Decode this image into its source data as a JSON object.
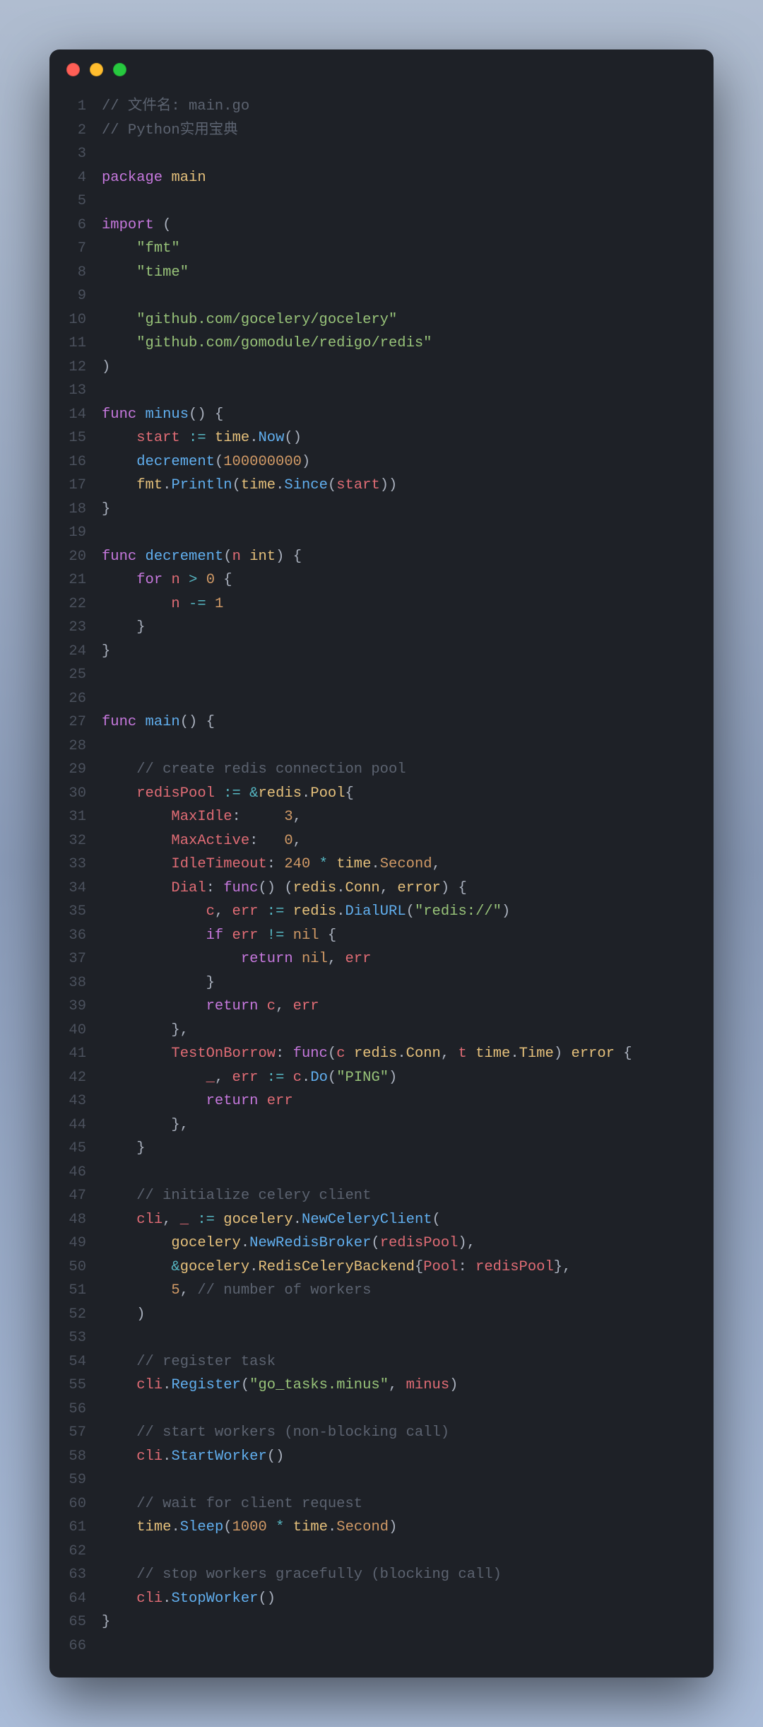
{
  "window": {
    "buttons": [
      "close",
      "minimize",
      "maximize"
    ]
  },
  "editor": {
    "language": "go",
    "line_count": 66,
    "lines": [
      [
        {
          "t": "// 文件名: main.go",
          "c": "comment"
        }
      ],
      [
        {
          "t": "// Python实用宝典",
          "c": "comment"
        }
      ],
      [],
      [
        {
          "t": "package",
          "c": "keyword"
        },
        {
          "t": " "
        },
        {
          "t": "main",
          "c": "pkg"
        }
      ],
      [],
      [
        {
          "t": "import",
          "c": "keyword"
        },
        {
          "t": " ("
        }
      ],
      [
        {
          "t": "    "
        },
        {
          "t": "\"fmt\"",
          "c": "string"
        }
      ],
      [
        {
          "t": "    "
        },
        {
          "t": "\"time\"",
          "c": "string"
        }
      ],
      [],
      [
        {
          "t": "    "
        },
        {
          "t": "\"github.com/gocelery/gocelery\"",
          "c": "string"
        }
      ],
      [
        {
          "t": "    "
        },
        {
          "t": "\"github.com/gomodule/redigo/redis\"",
          "c": "string"
        }
      ],
      [
        {
          "t": ")"
        }
      ],
      [],
      [
        {
          "t": "func",
          "c": "keyword"
        },
        {
          "t": " "
        },
        {
          "t": "minus",
          "c": "func"
        },
        {
          "t": "() {"
        }
      ],
      [
        {
          "t": "    "
        },
        {
          "t": "start",
          "c": "var"
        },
        {
          "t": " "
        },
        {
          "t": ":=",
          "c": "op"
        },
        {
          "t": " "
        },
        {
          "t": "time",
          "c": "pkg"
        },
        {
          "t": "."
        },
        {
          "t": "Now",
          "c": "func"
        },
        {
          "t": "()"
        }
      ],
      [
        {
          "t": "    "
        },
        {
          "t": "decrement",
          "c": "func"
        },
        {
          "t": "("
        },
        {
          "t": "100000000",
          "c": "num"
        },
        {
          "t": ")"
        }
      ],
      [
        {
          "t": "    "
        },
        {
          "t": "fmt",
          "c": "pkg"
        },
        {
          "t": "."
        },
        {
          "t": "Println",
          "c": "func"
        },
        {
          "t": "("
        },
        {
          "t": "time",
          "c": "pkg"
        },
        {
          "t": "."
        },
        {
          "t": "Since",
          "c": "func"
        },
        {
          "t": "("
        },
        {
          "t": "start",
          "c": "var"
        },
        {
          "t": "))"
        }
      ],
      [
        {
          "t": "}"
        }
      ],
      [],
      [
        {
          "t": "func",
          "c": "keyword"
        },
        {
          "t": " "
        },
        {
          "t": "decrement",
          "c": "func"
        },
        {
          "t": "("
        },
        {
          "t": "n",
          "c": "var"
        },
        {
          "t": " "
        },
        {
          "t": "int",
          "c": "type"
        },
        {
          "t": ") {"
        }
      ],
      [
        {
          "t": "    "
        },
        {
          "t": "for",
          "c": "keyword"
        },
        {
          "t": " "
        },
        {
          "t": "n",
          "c": "var"
        },
        {
          "t": " "
        },
        {
          "t": ">",
          "c": "op"
        },
        {
          "t": " "
        },
        {
          "t": "0",
          "c": "num"
        },
        {
          "t": " {"
        }
      ],
      [
        {
          "t": "        "
        },
        {
          "t": "n",
          "c": "var"
        },
        {
          "t": " "
        },
        {
          "t": "-=",
          "c": "op"
        },
        {
          "t": " "
        },
        {
          "t": "1",
          "c": "num"
        }
      ],
      [
        {
          "t": "    }"
        }
      ],
      [
        {
          "t": "}"
        }
      ],
      [],
      [],
      [
        {
          "t": "func",
          "c": "keyword"
        },
        {
          "t": " "
        },
        {
          "t": "main",
          "c": "func"
        },
        {
          "t": "() {"
        }
      ],
      [],
      [
        {
          "t": "    "
        },
        {
          "t": "// create redis connection pool",
          "c": "comment"
        }
      ],
      [
        {
          "t": "    "
        },
        {
          "t": "redisPool",
          "c": "var"
        },
        {
          "t": " "
        },
        {
          "t": ":=",
          "c": "op"
        },
        {
          "t": " "
        },
        {
          "t": "&",
          "c": "op"
        },
        {
          "t": "redis",
          "c": "pkg"
        },
        {
          "t": "."
        },
        {
          "t": "Pool",
          "c": "type"
        },
        {
          "t": "{"
        }
      ],
      [
        {
          "t": "        "
        },
        {
          "t": "MaxIdle",
          "c": "field"
        },
        {
          "t": ":     "
        },
        {
          "t": "3",
          "c": "num"
        },
        {
          "t": ","
        }
      ],
      [
        {
          "t": "        "
        },
        {
          "t": "MaxActive",
          "c": "field"
        },
        {
          "t": ":   "
        },
        {
          "t": "0",
          "c": "num"
        },
        {
          "t": ","
        }
      ],
      [
        {
          "t": "        "
        },
        {
          "t": "IdleTimeout",
          "c": "field"
        },
        {
          "t": ": "
        },
        {
          "t": "240",
          "c": "num"
        },
        {
          "t": " "
        },
        {
          "t": "*",
          "c": "op"
        },
        {
          "t": " "
        },
        {
          "t": "time",
          "c": "pkg"
        },
        {
          "t": "."
        },
        {
          "t": "Second",
          "c": "const"
        },
        {
          "t": ","
        }
      ],
      [
        {
          "t": "        "
        },
        {
          "t": "Dial",
          "c": "field"
        },
        {
          "t": ": "
        },
        {
          "t": "func",
          "c": "keyword"
        },
        {
          "t": "() ("
        },
        {
          "t": "redis",
          "c": "pkg"
        },
        {
          "t": "."
        },
        {
          "t": "Conn",
          "c": "type"
        },
        {
          "t": ", "
        },
        {
          "t": "error",
          "c": "type"
        },
        {
          "t": ") {"
        }
      ],
      [
        {
          "t": "            "
        },
        {
          "t": "c",
          "c": "var"
        },
        {
          "t": ", "
        },
        {
          "t": "err",
          "c": "var"
        },
        {
          "t": " "
        },
        {
          "t": ":=",
          "c": "op"
        },
        {
          "t": " "
        },
        {
          "t": "redis",
          "c": "pkg"
        },
        {
          "t": "."
        },
        {
          "t": "DialURL",
          "c": "func"
        },
        {
          "t": "("
        },
        {
          "t": "\"redis://\"",
          "c": "string"
        },
        {
          "t": ")"
        }
      ],
      [
        {
          "t": "            "
        },
        {
          "t": "if",
          "c": "keyword"
        },
        {
          "t": " "
        },
        {
          "t": "err",
          "c": "var"
        },
        {
          "t": " "
        },
        {
          "t": "!=",
          "c": "op"
        },
        {
          "t": " "
        },
        {
          "t": "nil",
          "c": "const"
        },
        {
          "t": " {"
        }
      ],
      [
        {
          "t": "                "
        },
        {
          "t": "return",
          "c": "keyword"
        },
        {
          "t": " "
        },
        {
          "t": "nil",
          "c": "const"
        },
        {
          "t": ", "
        },
        {
          "t": "err",
          "c": "var"
        }
      ],
      [
        {
          "t": "            }"
        }
      ],
      [
        {
          "t": "            "
        },
        {
          "t": "return",
          "c": "keyword"
        },
        {
          "t": " "
        },
        {
          "t": "c",
          "c": "var"
        },
        {
          "t": ", "
        },
        {
          "t": "err",
          "c": "var"
        }
      ],
      [
        {
          "t": "        },"
        }
      ],
      [
        {
          "t": "        "
        },
        {
          "t": "TestOnBorrow",
          "c": "field"
        },
        {
          "t": ": "
        },
        {
          "t": "func",
          "c": "keyword"
        },
        {
          "t": "("
        },
        {
          "t": "c",
          "c": "var"
        },
        {
          "t": " "
        },
        {
          "t": "redis",
          "c": "pkg"
        },
        {
          "t": "."
        },
        {
          "t": "Conn",
          "c": "type"
        },
        {
          "t": ", "
        },
        {
          "t": "t",
          "c": "var"
        },
        {
          "t": " "
        },
        {
          "t": "time",
          "c": "pkg"
        },
        {
          "t": "."
        },
        {
          "t": "Time",
          "c": "type"
        },
        {
          "t": ") "
        },
        {
          "t": "error",
          "c": "type"
        },
        {
          "t": " {"
        }
      ],
      [
        {
          "t": "            "
        },
        {
          "t": "_",
          "c": "var"
        },
        {
          "t": ", "
        },
        {
          "t": "err",
          "c": "var"
        },
        {
          "t": " "
        },
        {
          "t": ":=",
          "c": "op"
        },
        {
          "t": " "
        },
        {
          "t": "c",
          "c": "var"
        },
        {
          "t": "."
        },
        {
          "t": "Do",
          "c": "func"
        },
        {
          "t": "("
        },
        {
          "t": "\"PING\"",
          "c": "string"
        },
        {
          "t": ")"
        }
      ],
      [
        {
          "t": "            "
        },
        {
          "t": "return",
          "c": "keyword"
        },
        {
          "t": " "
        },
        {
          "t": "err",
          "c": "var"
        }
      ],
      [
        {
          "t": "        },"
        }
      ],
      [
        {
          "t": "    }"
        }
      ],
      [],
      [
        {
          "t": "    "
        },
        {
          "t": "// initialize celery client",
          "c": "comment"
        }
      ],
      [
        {
          "t": "    "
        },
        {
          "t": "cli",
          "c": "var"
        },
        {
          "t": ", "
        },
        {
          "t": "_",
          "c": "var"
        },
        {
          "t": " "
        },
        {
          "t": ":=",
          "c": "op"
        },
        {
          "t": " "
        },
        {
          "t": "gocelery",
          "c": "pkg"
        },
        {
          "t": "."
        },
        {
          "t": "NewCeleryClient",
          "c": "func"
        },
        {
          "t": "("
        }
      ],
      [
        {
          "t": "        "
        },
        {
          "t": "gocelery",
          "c": "pkg"
        },
        {
          "t": "."
        },
        {
          "t": "NewRedisBroker",
          "c": "func"
        },
        {
          "t": "("
        },
        {
          "t": "redisPool",
          "c": "var"
        },
        {
          "t": "),"
        }
      ],
      [
        {
          "t": "        "
        },
        {
          "t": "&",
          "c": "op"
        },
        {
          "t": "gocelery",
          "c": "pkg"
        },
        {
          "t": "."
        },
        {
          "t": "RedisCeleryBackend",
          "c": "type"
        },
        {
          "t": "{"
        },
        {
          "t": "Pool",
          "c": "field"
        },
        {
          "t": ": "
        },
        {
          "t": "redisPool",
          "c": "var"
        },
        {
          "t": "},"
        }
      ],
      [
        {
          "t": "        "
        },
        {
          "t": "5",
          "c": "num"
        },
        {
          "t": ", "
        },
        {
          "t": "// number of workers",
          "c": "comment"
        }
      ],
      [
        {
          "t": "    )"
        }
      ],
      [],
      [
        {
          "t": "    "
        },
        {
          "t": "// register task",
          "c": "comment"
        }
      ],
      [
        {
          "t": "    "
        },
        {
          "t": "cli",
          "c": "var"
        },
        {
          "t": "."
        },
        {
          "t": "Register",
          "c": "func"
        },
        {
          "t": "("
        },
        {
          "t": "\"go_tasks.minus\"",
          "c": "string"
        },
        {
          "t": ", "
        },
        {
          "t": "minus",
          "c": "var"
        },
        {
          "t": ")"
        }
      ],
      [],
      [
        {
          "t": "    "
        },
        {
          "t": "// start workers (non-blocking call)",
          "c": "comment"
        }
      ],
      [
        {
          "t": "    "
        },
        {
          "t": "cli",
          "c": "var"
        },
        {
          "t": "."
        },
        {
          "t": "StartWorker",
          "c": "func"
        },
        {
          "t": "()"
        }
      ],
      [],
      [
        {
          "t": "    "
        },
        {
          "t": "// wait for client request",
          "c": "comment"
        }
      ],
      [
        {
          "t": "    "
        },
        {
          "t": "time",
          "c": "pkg"
        },
        {
          "t": "."
        },
        {
          "t": "Sleep",
          "c": "func"
        },
        {
          "t": "("
        },
        {
          "t": "1000",
          "c": "num"
        },
        {
          "t": " "
        },
        {
          "t": "*",
          "c": "op"
        },
        {
          "t": " "
        },
        {
          "t": "time",
          "c": "pkg"
        },
        {
          "t": "."
        },
        {
          "t": "Second",
          "c": "const"
        },
        {
          "t": ")"
        }
      ],
      [],
      [
        {
          "t": "    "
        },
        {
          "t": "// stop workers gracefully (blocking call)",
          "c": "comment"
        }
      ],
      [
        {
          "t": "    "
        },
        {
          "t": "cli",
          "c": "var"
        },
        {
          "t": "."
        },
        {
          "t": "StopWorker",
          "c": "func"
        },
        {
          "t": "()"
        }
      ],
      [
        {
          "t": "}"
        }
      ],
      []
    ]
  }
}
